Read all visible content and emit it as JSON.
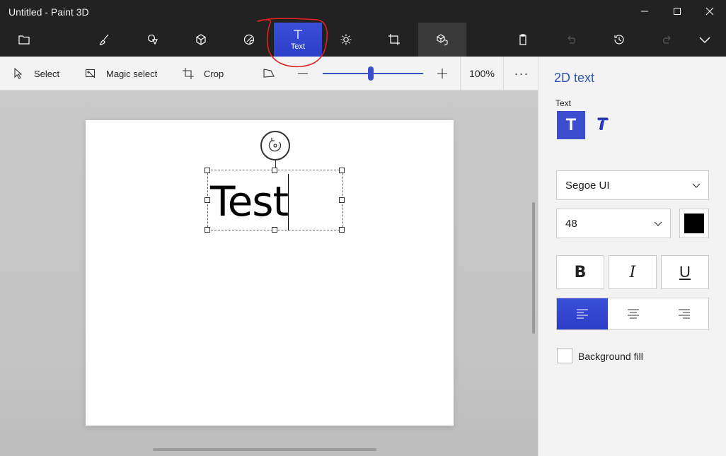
{
  "window": {
    "title": "Untitled - Paint 3D"
  },
  "ribbon": {
    "text_label": "Text"
  },
  "toolbar": {
    "select_label": "Select",
    "magic_select_label": "Magic select",
    "crop_label": "Crop",
    "zoom_value": "100%",
    "zoom_level": 0.48
  },
  "canvas": {
    "text": "Test"
  },
  "panel": {
    "title": "2D text",
    "text_section_label": "Text",
    "font_family": "Segoe UI",
    "font_size": "48",
    "text_color": "#000000",
    "bold_label": "B",
    "italic_label": "I",
    "underline_label": "U",
    "alignment": "left",
    "background_fill_label": "Background fill",
    "background_fill_checked": false
  },
  "colors": {
    "accent": "#3c4dd0",
    "title_blue": "#2b57b8",
    "annotation": "#e02020"
  }
}
